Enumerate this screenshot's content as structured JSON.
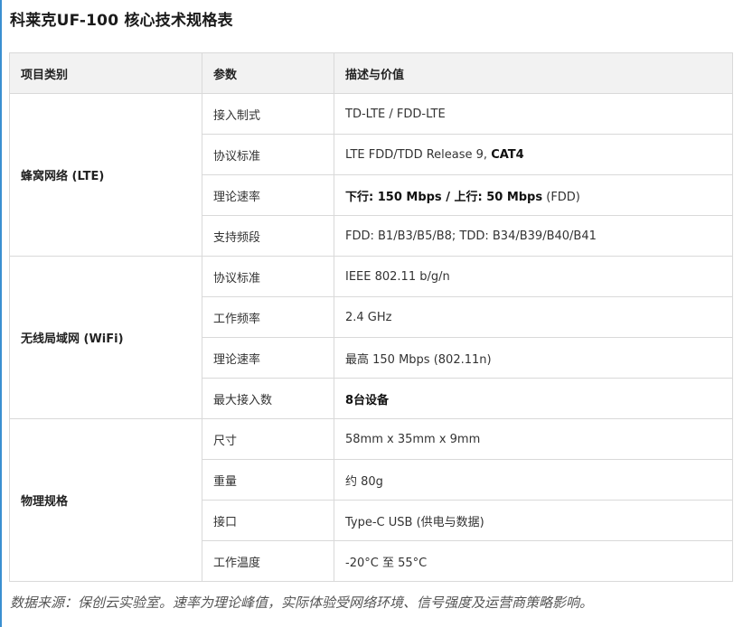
{
  "title": "科莱克UF-100 核心技术规格表",
  "headers": [
    "项目类别",
    "参数",
    "描述与价值"
  ],
  "groups": [
    {
      "category": "蜂窝网络 (LTE)",
      "rows": [
        {
          "param": "接入制式",
          "desc": [
            {
              "t": "TD-LTE / FDD-LTE",
              "b": false
            }
          ]
        },
        {
          "param": "协议标准",
          "desc": [
            {
              "t": "LTE FDD/TDD Release 9, ",
              "b": false
            },
            {
              "t": "CAT4",
              "b": true
            }
          ]
        },
        {
          "param": "理论速率",
          "desc": [
            {
              "t": "下行: 150 Mbps / 上行: 50 Mbps",
              "b": true
            },
            {
              "t": " (FDD)",
              "b": false
            }
          ]
        },
        {
          "param": "支持频段",
          "desc": [
            {
              "t": "FDD: B1/B3/B5/B8; TDD: B34/B39/B40/B41",
              "b": false
            }
          ]
        }
      ]
    },
    {
      "category": "无线局域网 (WiFi)",
      "rows": [
        {
          "param": "协议标准",
          "desc": [
            {
              "t": "IEEE 802.11 b/g/n",
              "b": false
            }
          ]
        },
        {
          "param": "工作频率",
          "desc": [
            {
              "t": "2.4 GHz",
              "b": false
            }
          ]
        },
        {
          "param": "理论速率",
          "desc": [
            {
              "t": "最高 150 Mbps (802.11n)",
              "b": false
            }
          ]
        },
        {
          "param": "最大接入数",
          "desc": [
            {
              "t": "8台设备",
              "b": true
            }
          ]
        }
      ]
    },
    {
      "category": "物理规格",
      "rows": [
        {
          "param": "尺寸",
          "desc": [
            {
              "t": "58mm x 35mm x 9mm",
              "b": false
            }
          ]
        },
        {
          "param": "重量",
          "desc": [
            {
              "t": "约 80g",
              "b": false
            }
          ]
        },
        {
          "param": "接口",
          "desc": [
            {
              "t": "Type-C USB (供电与数据)",
              "b": false
            }
          ]
        },
        {
          "param": "工作温度",
          "desc": [
            {
              "t": "-20°C 至 55°C",
              "b": false
            }
          ]
        }
      ]
    }
  ],
  "footnote": "数据来源：保创云实验室。速率为理论峰值，实际体验受网络环境、信号强度及运营商策略影响。",
  "colors": {
    "accent_bar": "#3a8fd1",
    "header_bg": "#f2f2f2",
    "border": "#d9d9d9"
  }
}
